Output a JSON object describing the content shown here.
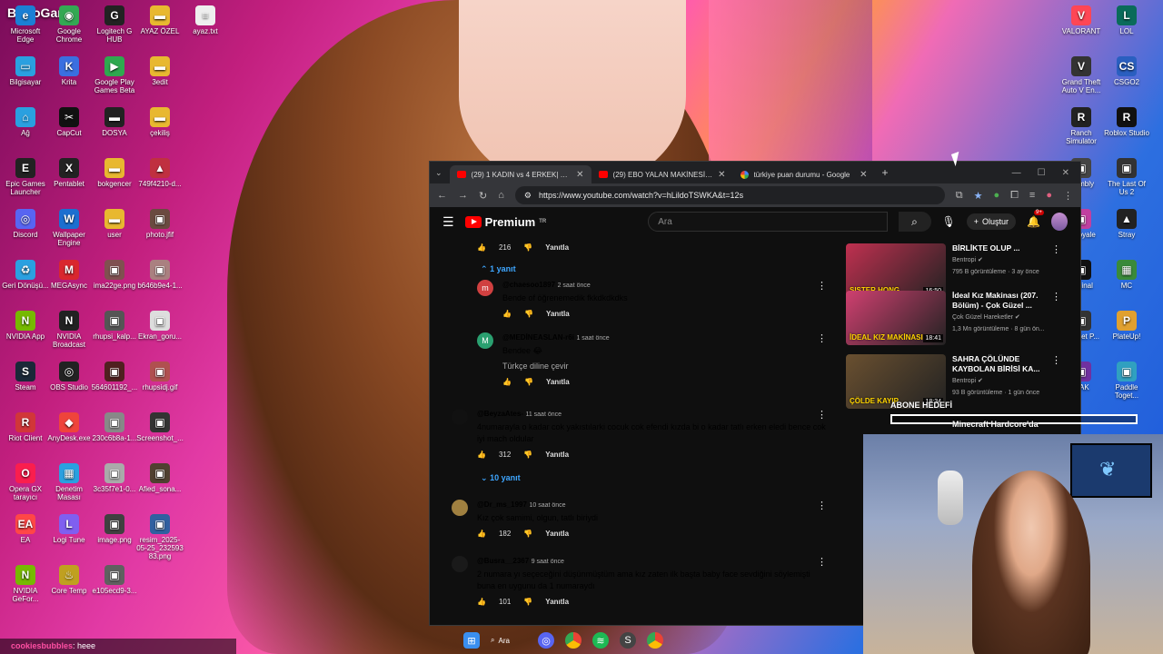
{
  "brand": "ByNoGame",
  "desktop_left": [
    {
      "label": "Microsoft Edge",
      "icon": "edge-icon",
      "color": "#1b7fd4",
      "ch": "e"
    },
    {
      "label": "Google Chrome",
      "icon": "chrome-icon",
      "color": "#34a853",
      "ch": "◉"
    },
    {
      "label": "Logitech G HUB",
      "icon": "logitech-icon",
      "color": "#222222",
      "ch": "G"
    },
    {
      "label": "AYAZ ÖZEL",
      "icon": "folder-icon",
      "color": "#e8b830",
      "ch": "▬"
    },
    {
      "label": "ayaz.txt",
      "icon": "text-file-icon",
      "color": "#eeeeee",
      "ch": "≡"
    },
    {
      "label": "Bilgisayar",
      "icon": "computer-icon",
      "color": "#2aa0e0",
      "ch": "▭"
    },
    {
      "label": "Krita",
      "icon": "krita-icon",
      "color": "#3a6fe0",
      "ch": "K"
    },
    {
      "label": "Google Play Games Beta",
      "icon": "play-games-icon",
      "color": "#2fa84f",
      "ch": "▶"
    },
    {
      "label": "3edit",
      "icon": "folder-icon",
      "color": "#e8b830",
      "ch": "▬"
    },
    {
      "label": "Ağ",
      "icon": "network-icon",
      "color": "#2aa0e0",
      "ch": "⌂"
    },
    {
      "label": "CapCut",
      "icon": "capcut-icon",
      "color": "#111111",
      "ch": "✂"
    },
    {
      "label": "DOSYA",
      "icon": "folder-icon",
      "color": "#222222",
      "ch": "▬"
    },
    {
      "label": "çekiliş",
      "icon": "folder-icon",
      "color": "#e8b830",
      "ch": "▬"
    },
    {
      "label": "Epic Games Launcher",
      "icon": "epic-icon",
      "color": "#222222",
      "ch": "E"
    },
    {
      "label": "Pentablet",
      "icon": "pentablet-icon",
      "color": "#222222",
      "ch": "X"
    },
    {
      "label": "bokgencer",
      "icon": "folder-icon",
      "color": "#e8b830",
      "ch": "▬"
    },
    {
      "label": "749f4210-d...",
      "icon": "image-file-icon",
      "color": "#c03040",
      "ch": "▲"
    },
    {
      "label": "Discord",
      "icon": "discord-icon",
      "color": "#5865f2",
      "ch": "◎"
    },
    {
      "label": "Wallpaper Engine",
      "icon": "wallpaper-engine-icon",
      "color": "#1c6fd0",
      "ch": "W"
    },
    {
      "label": "user",
      "icon": "folder-icon",
      "color": "#e8b830",
      "ch": "▬"
    },
    {
      "label": "photo.jfif",
      "icon": "image-file-icon",
      "color": "#6a4a40",
      "ch": "▣"
    },
    {
      "label": "Geri Dönüşü...",
      "icon": "recycle-bin-icon",
      "color": "#2aa0e0",
      "ch": "♻"
    },
    {
      "label": "MEGAsync",
      "icon": "mega-icon",
      "color": "#d9272e",
      "ch": "M"
    },
    {
      "label": "ima22ge.png",
      "icon": "image-file-icon",
      "color": "#805050",
      "ch": "▣"
    },
    {
      "label": "b646b9e4-1...",
      "icon": "image-file-icon",
      "color": "#aa8080",
      "ch": "▣"
    },
    {
      "label": "NVIDIA App",
      "icon": "nvidia-icon",
      "color": "#76b900",
      "ch": "N"
    },
    {
      "label": "NVIDIA Broadcast",
      "icon": "nvidia-broadcast-icon",
      "color": "#222222",
      "ch": "N"
    },
    {
      "label": "rhupsi_kalp...",
      "icon": "image-file-icon",
      "color": "#555555",
      "ch": "▣"
    },
    {
      "label": "Ekran_goru...",
      "icon": "image-file-icon",
      "color": "#dddddd",
      "ch": "▣"
    },
    {
      "label": "Steam",
      "icon": "steam-icon",
      "color": "#1b2838",
      "ch": "S"
    },
    {
      "label": "OBS Studio",
      "icon": "obs-icon",
      "color": "#222222",
      "ch": "◎"
    },
    {
      "label": "564601192_...",
      "icon": "image-file-icon",
      "color": "#502020",
      "ch": "▣"
    },
    {
      "label": "rhupsidj.gif",
      "icon": "image-file-icon",
      "color": "#b05050",
      "ch": "▣"
    },
    {
      "label": "Riot Client",
      "icon": "riot-icon",
      "color": "#d13639",
      "ch": "R"
    },
    {
      "label": "AnyDesk.exe",
      "icon": "anydesk-icon",
      "color": "#ef443b",
      "ch": "◆"
    },
    {
      "label": "230c6b8a-1...",
      "icon": "image-file-icon",
      "color": "#888888",
      "ch": "▣"
    },
    {
      "label": "Screenshot_...",
      "icon": "image-file-icon",
      "color": "#333333",
      "ch": "▣"
    },
    {
      "label": "Opera GX tarayıcı",
      "icon": "opera-gx-icon",
      "color": "#fa1e4e",
      "ch": "O"
    },
    {
      "label": "Denetim Masası",
      "icon": "control-panel-icon",
      "color": "#2aa0e0",
      "ch": "▦"
    },
    {
      "label": "3c35f7e1-0...",
      "icon": "image-file-icon",
      "color": "#aaaaaa",
      "ch": "▣"
    },
    {
      "label": "Afied_sona...",
      "icon": "image-file-icon",
      "color": "#504030",
      "ch": "▣"
    },
    {
      "label": "EA",
      "icon": "ea-icon",
      "color": "#ff4747",
      "ch": "EA"
    },
    {
      "label": "Logi Tune",
      "icon": "logi-tune-icon",
      "color": "#7f5ff0",
      "ch": "L"
    },
    {
      "label": "image.png",
      "icon": "image-file-icon",
      "color": "#404040",
      "ch": "▣"
    },
    {
      "label": "resim_2025-05-25_232593 83.png",
      "icon": "image-file-icon",
      "color": "#3060a0",
      "ch": "▣"
    },
    {
      "label": "NVIDIA GeFor...",
      "icon": "geforce-icon",
      "color": "#76b900",
      "ch": "N"
    },
    {
      "label": "Core Temp",
      "icon": "core-temp-icon",
      "color": "#c0a020",
      "ch": "♨"
    },
    {
      "label": "e105ecd9-3...",
      "icon": "image-file-icon",
      "color": "#606060",
      "ch": "▣"
    }
  ],
  "desktop_right": [
    {
      "label": "VALORANT",
      "icon": "valorant-icon",
      "color": "#ff4655",
      "ch": "V"
    },
    {
      "label": "LOL",
      "icon": "lol-icon",
      "color": "#0a6b5a",
      "ch": "L"
    },
    {
      "label": "Grand Theft Auto V En...",
      "icon": "gta-icon",
      "color": "#333333",
      "ch": "V"
    },
    {
      "label": "CSGO2",
      "icon": "csgo-icon",
      "color": "#2a5fc0",
      "ch": "CS"
    },
    {
      "label": "Ranch Simulator",
      "icon": "ranch-icon",
      "color": "#222222",
      "ch": "R"
    },
    {
      "label": "Roblox Studio",
      "icon": "roblox-icon",
      "color": "#111111",
      "ch": "R"
    },
    {
      "label": "...embly",
      "icon": "app-icon",
      "color": "#444444",
      "ch": "▣"
    },
    {
      "label": "The Last Of Us 2",
      "icon": "tlou-icon",
      "color": "#333333",
      "ch": "▣"
    },
    {
      "label": "...Royale",
      "icon": "app-icon",
      "color": "#c040a0",
      "ch": "▣"
    },
    {
      "label": "Stray",
      "icon": "stray-icon",
      "color": "#222222",
      "ch": "▲"
    },
    {
      "label": "...minal",
      "icon": "app-icon",
      "color": "#111111",
      "ch": "▣"
    },
    {
      "label": "MC",
      "icon": "minecraft-icon",
      "color": "#3a8a3a",
      "ch": "▦"
    },
    {
      "label": "...udget P...",
      "icon": "app-icon",
      "color": "#333333",
      "ch": "▣"
    },
    {
      "label": "PlateUp!",
      "icon": "plateup-icon",
      "color": "#e0a030",
      "ch": "P"
    },
    {
      "label": "...AK",
      "icon": "app-icon",
      "color": "#7030a0",
      "ch": "▣"
    },
    {
      "label": "Paddle Toget...",
      "icon": "paddle-icon",
      "color": "#30a0c0",
      "ch": "▣"
    }
  ],
  "browser": {
    "tabs": [
      {
        "label": "(29) 1 KADIN vs 4 ERKEK| KIYAF",
        "active": true,
        "favicon": "youtube"
      },
      {
        "label": "(29) EBO YALAN MAKİNESİNDE",
        "active": false,
        "favicon": "youtube"
      },
      {
        "label": "türkiye puan durumu - Google",
        "active": false,
        "favicon": "google"
      }
    ],
    "url": "https://www.youtube.com/watch?v=hLildoTSWKA&t=12s"
  },
  "youtube": {
    "logo": "Premium",
    "logo_sup": "TR",
    "search_placeholder": "Ara",
    "create_label": "Oluştur",
    "notif_count": "9+",
    "top_likes": "216",
    "reply_label": "Yanıtla",
    "collapse_label": "1 yanıt",
    "comments": [
      {
        "handle": "@chaesoo1897",
        "time": "2 saat önce",
        "text": "Bende of öğrenemedik  fkkdkdkdks",
        "likes": "",
        "avatar_color": "#d04040",
        "avatar_ch": "m"
      },
      {
        "handle": "@MEDİNEASLAN-r6i",
        "time": "1 saat önce",
        "text": "Bendee 😂",
        "translate": "Türkçe diline çevir",
        "likes": "",
        "avatar_color": "#2aa070",
        "avatar_ch": "M"
      },
      {
        "handle": "@BeyzaAtes-",
        "time": "11 saat önce",
        "text": "4numarayla o kadar cok yakıstılarki cocuk cok efendi kızda bi o kadar  tatlı erken eledi bence cok iyi mach oldular",
        "likes": "312",
        "avatar_color": "#111111",
        "avatar_ch": ""
      },
      {
        "handle": "@Dr_ms_1997",
        "time": "10 saat önce",
        "text": "Kız çok samimi, olgun, tatlı biriydi",
        "likes": "182",
        "avatar_color": "#a08040",
        "avatar_ch": ""
      },
      {
        "handle": "@Busra__2367",
        "time": "9 saat önce",
        "text": "2 numara yı seçeceğini düşünmüştüm ama kız zaten ilk başta baby face sevdiğini söylemişti buna en uygunu da 1 numaraydı",
        "likes": "101",
        "avatar_color": "#1a1a1a",
        "avatar_ch": ""
      }
    ],
    "replies_toggle": "10 yanıt",
    "videos": [
      {
        "title": "BİRLİKTE OLUP ...",
        "channel": "Bentropi",
        "meta": "795 B görüntüleme · 3 ay önce",
        "duration": "16:50",
        "thumb_text": "SISTER HONG",
        "color": "#c03050"
      },
      {
        "title": "İdeal Kız Makinası (207. Bölüm) - Çok Güzel ...",
        "channel": "Çok Güzel Hareketler",
        "meta": "1,3 Mn görüntüleme · 8 gün ön...",
        "duration": "18:41",
        "thumb_text": "İDEAL KIZ MAKİNASI",
        "color": "#d04070"
      },
      {
        "title": "SAHRA ÇÖLÜNDE KAYBOLAN BİRİSİ KA...",
        "channel": "Bentropi",
        "meta": "93 B görüntüleme · 1 gün önce",
        "duration": "18:34",
        "thumb_text": "ÇÖLDE KAYIP",
        "color": "#6a5030"
      }
    ]
  },
  "overlay": {
    "abone_label": "ABONE HEDEFİ",
    "mc_label": "Minecraft Hardcore'da"
  },
  "chat": {
    "user": "cookiesbubbles",
    "message": ": heee"
  },
  "taskbar": {
    "search_label": "Ara"
  }
}
